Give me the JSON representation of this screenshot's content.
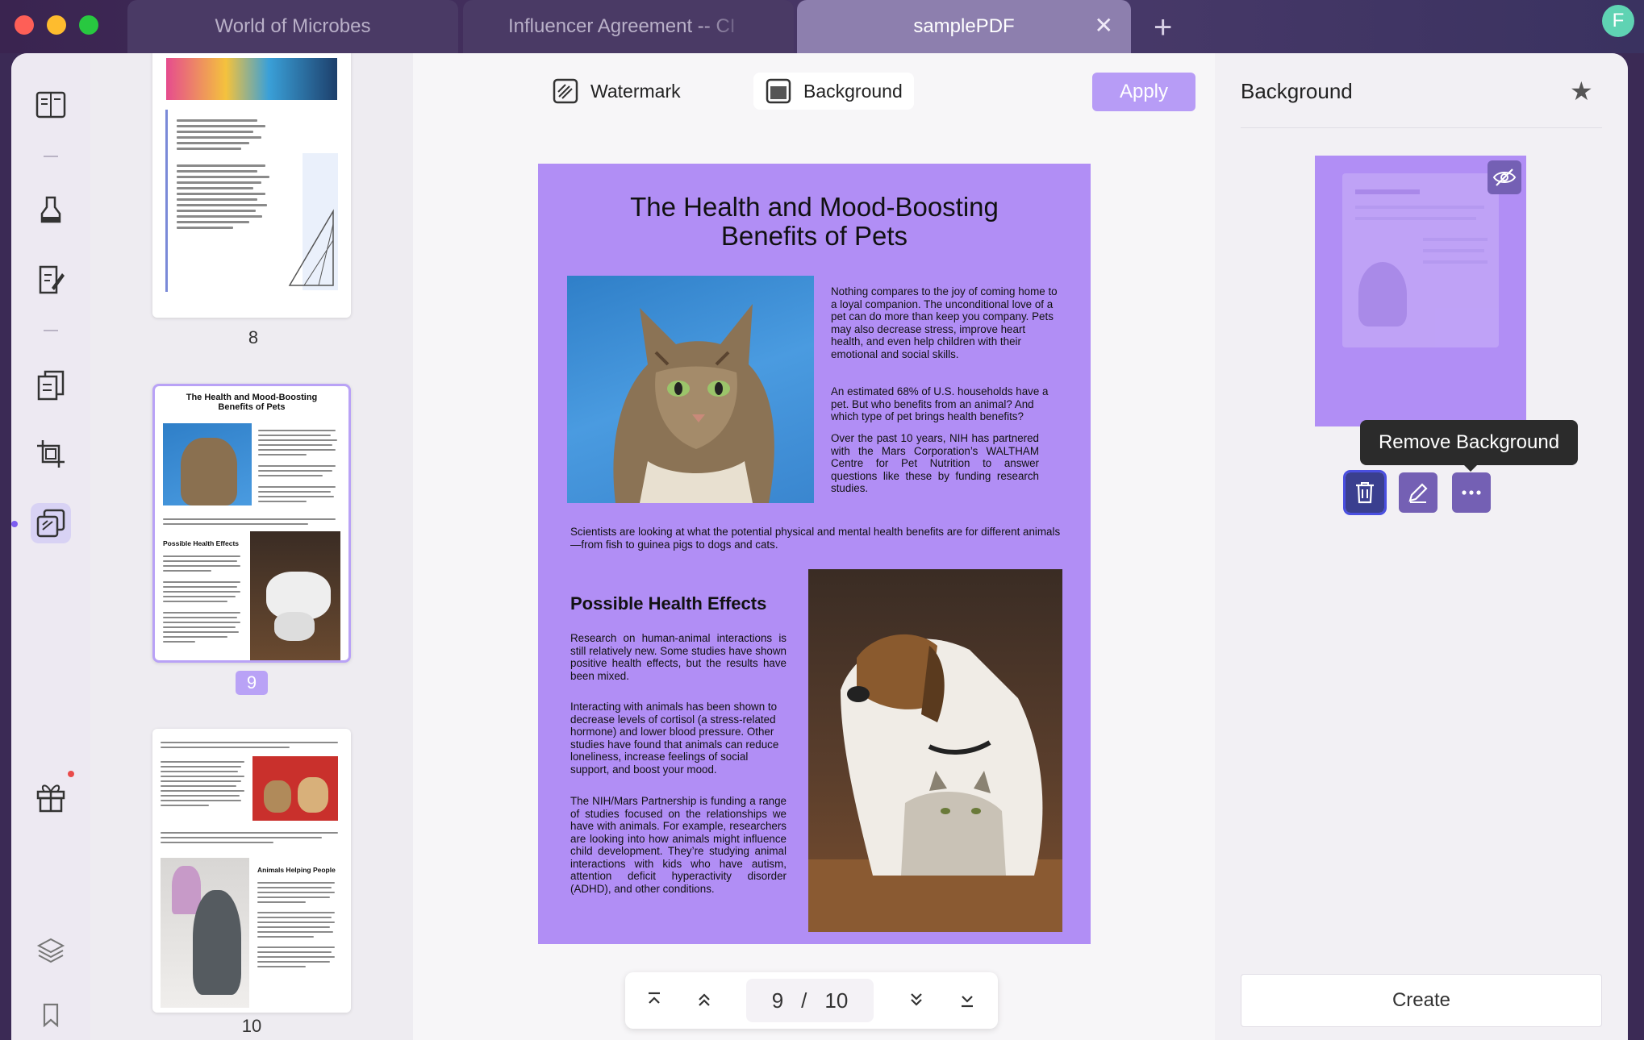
{
  "tabs": [
    {
      "label": "World of Microbes"
    },
    {
      "label": "Influencer Agreement -- CI"
    },
    {
      "label": "samplePDF",
      "close": "✕"
    }
  ],
  "new_tab": "+",
  "avatar_initial": "F",
  "toolbar": {
    "watermark": "Watermark",
    "background": "Background",
    "apply": "Apply"
  },
  "thumbnails": [
    {
      "page": "8"
    },
    {
      "page": "9",
      "title": "The Health and Mood-Boosting Benefits of Pets",
      "heading": "Possible Health Effects"
    },
    {
      "page": "10",
      "heading": "Animals Helping People"
    }
  ],
  "page": {
    "title_line1": "The Health and Mood-Boosting",
    "title_line2": "Benefits of Pets",
    "p1": "Nothing compares to the joy of coming home to a loyal companion. The unconditional love of a pet can do more than keep you company. Pets may also decrease stress, improve heart health, and even help children with their emotional and social skills.",
    "p2": "An estimated 68% of U.S. households have a pet. But who benefits from an animal? And which type of pet brings health benefits?",
    "p3": "Over the past 10 years, NIH has partnered with the Mars Corporation’s WALTHAM Centre for Pet Nutrition to answer questions like these by funding research studies.",
    "p4": "Scientists are looking at what the potential physical and mental health benefits are for different animals—from fish to guinea pigs to dogs and cats.",
    "heading": "Possible Health Effects",
    "p5": "Research on human-animal interactions is still relatively new. Some studies have shown positive health effects, but the results have been mixed.",
    "p6": "Interacting with animals has been shown to decrease levels of cortisol (a stress-related hormone) and lower blood pressure. Other studies have found that animals can reduce loneliness, increase feelings of social support, and boost your mood.",
    "p7": "The NIH/Mars Partnership is funding a range of studies focused on the relationships we have with animals. For example, researchers are looking into how animals might influence child development. They’re studying animal interactions with kids who have autism, attention deficit hyperactivity disorder (ADHD), and other conditions."
  },
  "pager": {
    "current": "9",
    "separator": "/",
    "total": "10"
  },
  "right_panel": {
    "title": "Background",
    "tooltip": "Remove Background",
    "create": "Create"
  },
  "colors": {
    "accent": "#b79cf6",
    "page_background": "#b18ef5",
    "selected_outline": "#b9a2f6"
  }
}
